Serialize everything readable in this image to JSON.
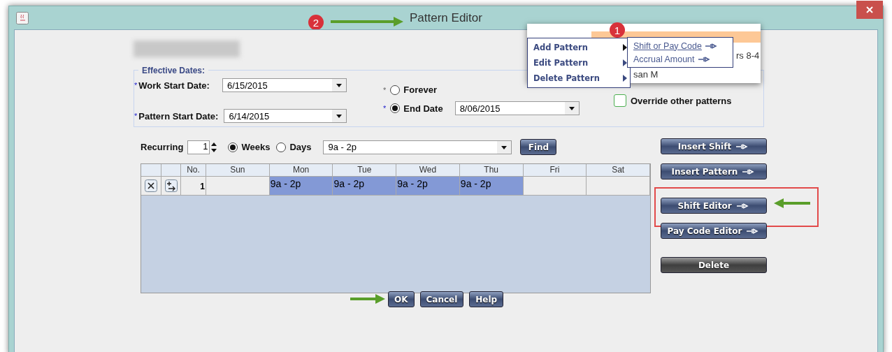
{
  "window": {
    "title": "Pattern Editor",
    "callout": "2"
  },
  "effective_dates": {
    "legend": "Effective Dates:",
    "work_start": {
      "marker": "*",
      "label": "Work Start Date:",
      "value": "6/15/2015"
    },
    "pattern_start": {
      "marker": "*",
      "label": "Pattern Start Date:",
      "value": "6/14/2015"
    },
    "end_options": [
      {
        "marker": "*",
        "label": "Forever",
        "selected": false
      },
      {
        "marker": "*",
        "label": "End Date",
        "selected": true
      }
    ],
    "end_date": "8/06/2015",
    "override": {
      "label": "Override other patterns",
      "checked": false
    }
  },
  "recurring": {
    "label": "Recurring",
    "value": "1",
    "units": [
      {
        "label": "Weeks",
        "selected": true
      },
      {
        "label": "Days",
        "selected": false
      }
    ],
    "shift": "9a - 2p",
    "find": "Find"
  },
  "table": {
    "columns": [
      "No.",
      "Sun",
      "Mon",
      "Tue",
      "Wed",
      "Thu",
      "Fri",
      "Sat"
    ],
    "rows": [
      {
        "no": "1",
        "cells": [
          {
            "selected": false
          },
          {
            "text": "9a - 2p",
            "selected": true
          },
          {
            "text": "9a - 2p",
            "selected": true
          },
          {
            "text": "9a - 2p",
            "selected": true
          },
          {
            "text": "9a - 2p",
            "selected": true
          },
          {
            "selected": false
          },
          {
            "selected": false
          }
        ]
      }
    ]
  },
  "side_buttons": [
    {
      "label": "Insert Shift",
      "kind": "arrow"
    },
    {
      "label": "Insert Pattern",
      "kind": "arrow"
    },
    {
      "label": "Shift Editor",
      "kind": "framed"
    },
    {
      "label": "Pay Code Editor",
      "kind": "arrow"
    },
    {
      "label": "Delete",
      "kind": "dark"
    }
  ],
  "footer_buttons": [
    "OK",
    "Cancel",
    "Help"
  ],
  "inset": {
    "callout": "1",
    "fragments": [
      "rs 8-4",
      "san M"
    ],
    "menu": [
      {
        "label": "Add Pattern",
        "expanded": true
      },
      {
        "label": "Edit Pattern",
        "expanded": false
      },
      {
        "label": "Delete Pattern",
        "expanded": false
      }
    ],
    "submenu": [
      {
        "label": "Shift or Pay Code",
        "selected": true
      },
      {
        "label": "Accrual Amount",
        "selected": false
      }
    ]
  }
}
